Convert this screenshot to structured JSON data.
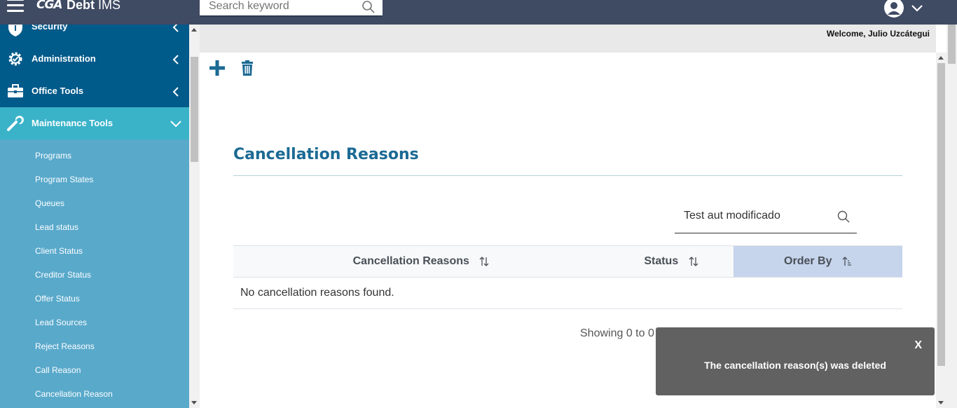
{
  "header": {
    "logo_mark": "CGA",
    "app_name_bold": "Debt",
    "app_name_rest": " IMS",
    "search_placeholder": "Search keyword"
  },
  "welcome": "Welcome, Julio Uzcátegui",
  "sidebar": {
    "groups": [
      {
        "label": "Security",
        "icon": "shield-icon"
      },
      {
        "label": "Administration",
        "icon": "gear-icon"
      },
      {
        "label": "Office Tools",
        "icon": "briefcase-icon"
      },
      {
        "label": "Maintenance Tools",
        "icon": "wrench-icon"
      }
    ],
    "items": [
      {
        "label": "Programs"
      },
      {
        "label": "Program States"
      },
      {
        "label": "Queues"
      },
      {
        "label": "Lead status"
      },
      {
        "label": "Client Status"
      },
      {
        "label": "Creditor Status"
      },
      {
        "label": "Offer Status"
      },
      {
        "label": "Lead Sources"
      },
      {
        "label": "Reject Reasons"
      },
      {
        "label": "Call Reason"
      },
      {
        "label": "Cancellation Reason"
      }
    ]
  },
  "page": {
    "title": "Cancellation Reasons",
    "filter_value": "Test aut modificado",
    "table": {
      "headers": [
        "Cancellation Reasons",
        "Status",
        "Order By"
      ],
      "empty_message": "No cancellation reasons found."
    },
    "showing": "Showing 0 to 0"
  },
  "toast": {
    "close": "X",
    "message": "The cancellation reason(s) was deleted"
  },
  "colors": {
    "topbar": "#3f4a63",
    "sidebar_group": "#005a8a",
    "sidebar_active": "#3ab3c9",
    "sidebar_bg": "#59a9cb",
    "title": "#1b6a94",
    "sorted_header": "#c6d4ec",
    "toast": "#616161"
  }
}
